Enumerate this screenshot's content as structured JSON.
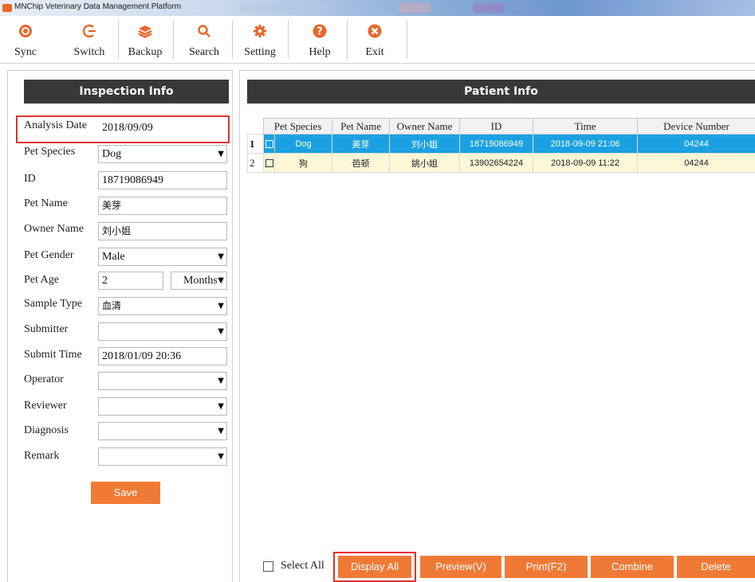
{
  "window": {
    "title": "MNChip Veterinary Data Management Platform"
  },
  "toolbar": {
    "items": [
      {
        "label": "Sync",
        "icon": "sync-icon"
      },
      {
        "label": "Switch",
        "icon": "switch-icon"
      },
      {
        "label": "Backup",
        "icon": "backup-icon"
      },
      {
        "label": "Search",
        "icon": "search-icon"
      },
      {
        "label": "Setting",
        "icon": "gear-icon"
      },
      {
        "label": "Help",
        "icon": "help-icon"
      },
      {
        "label": "Exit",
        "icon": "close-icon"
      }
    ]
  },
  "inspection": {
    "header": "Inspection Info",
    "fields": {
      "analysis_date": {
        "label": "Analysis Date",
        "value": "2018/09/09"
      },
      "pet_species": {
        "label": "Pet Species",
        "value": "Dog"
      },
      "id": {
        "label": "ID",
        "value": "18719086949"
      },
      "pet_name": {
        "label": "Pet Name",
        "value": "美芽"
      },
      "owner_name": {
        "label": "Owner Name",
        "value": "刘小姐"
      },
      "pet_gender": {
        "label": "Pet Gender",
        "value": "Male"
      },
      "pet_age": {
        "label": "Pet Age",
        "value": "2",
        "unit": "Months"
      },
      "sample_type": {
        "label": "Sample Type",
        "value": "血清"
      },
      "submitter": {
        "label": "Submitter",
        "value": ""
      },
      "submit_time": {
        "label": "Submit Time",
        "value": "2018/01/09 20:36"
      },
      "operator": {
        "label": "Operator",
        "value": ""
      },
      "reviewer": {
        "label": "Reviewer",
        "value": ""
      },
      "diagnosis": {
        "label": "Diagnosis",
        "value": ""
      },
      "remark": {
        "label": "Remark",
        "value": ""
      }
    },
    "save_label": "Save"
  },
  "patient": {
    "header": "Patient Info",
    "columns": [
      "Pet Species",
      "Pet Name",
      "Owner Name",
      "ID",
      "Time",
      "Device Number"
    ],
    "rows": [
      {
        "num": "1",
        "species": "Dog",
        "pet_name": "美芽",
        "owner": "刘小姐",
        "id": "18719086949",
        "time": "2018-09-09 21:06",
        "device": "04244"
      },
      {
        "num": "2",
        "species": "狗",
        "pet_name": "芭顿",
        "owner": "姚小姐",
        "id": "13902654224",
        "time": "2018-09-09 11:22",
        "device": "04244"
      }
    ]
  },
  "actions": {
    "select_all": "Select All",
    "display_all": "Display All",
    "preview": "Preview(V)",
    "print": "Print(F2)",
    "combine": "Combine",
    "delete": "Delete"
  },
  "colors": {
    "accent": "#f07a35",
    "selected_row": "#1ba1e2",
    "alt_row": "#fdf7d8",
    "highlight": "#e0322f",
    "header_bg": "#383838"
  }
}
